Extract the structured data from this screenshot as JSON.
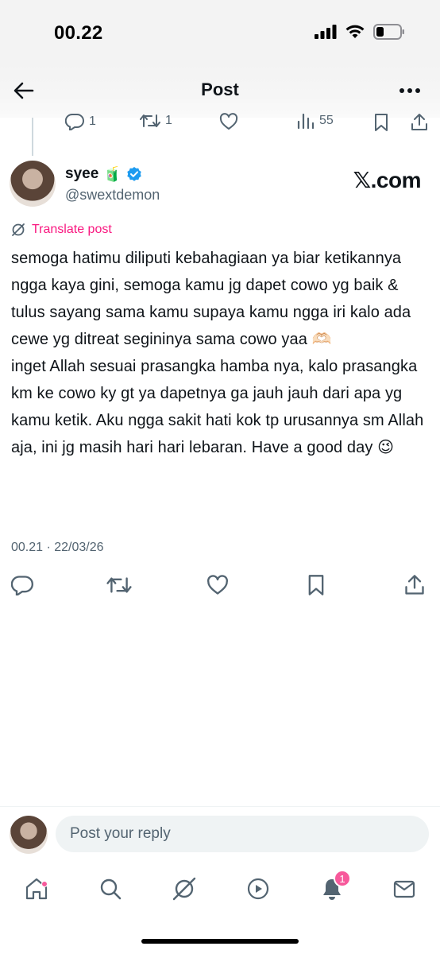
{
  "status_bar": {
    "time": "00.22"
  },
  "header": {
    "title": "Post"
  },
  "previous_tweet": {
    "reply_count": "1",
    "repost_count": "1",
    "view_count": "55"
  },
  "author": {
    "name": "syee",
    "name_emoji": "🧃",
    "handle": "@swextdemon",
    "verified": true
  },
  "watermark": "𝕏.com",
  "translate_label": "Translate post",
  "tweet": {
    "text": "semoga hatimu diliputi kebahagiaan ya biar ketikannya ngga kaya gini, semoga kamu jg dapet cowo yg baik & tulus sayang sama kamu supaya kamu ngga iri kalo ada cewe yg ditreat segininya sama cowo yaa 🫶🏻\ninget Allah sesuai prasangka hamba nya, kalo prasangka km ke cowo ky gt ya dapetnya ga jauh jauh dari apa yg kamu ketik. Aku ngga sakit hati kok tp urusannya sm Allah aja, ini jg masih hari hari lebaran. Have a good day 😉",
    "timestamp": "00.21 · 22/03/26"
  },
  "reply": {
    "placeholder": "Post your reply"
  },
  "tabs": {
    "notifications_badge": "1"
  },
  "colors": {
    "accent_pink": "#f91880",
    "verified_blue": "#1d9bf0",
    "secondary_text": "#536471"
  },
  "icons": [
    "back-arrow-icon",
    "more-icon",
    "reply-icon",
    "repost-icon",
    "like-icon",
    "views-icon",
    "bookmark-icon",
    "share-icon",
    "translate-icon",
    "home-icon",
    "search-icon",
    "grok-icon",
    "video-icon",
    "notifications-icon",
    "messages-icon",
    "verified-badge-icon"
  ]
}
